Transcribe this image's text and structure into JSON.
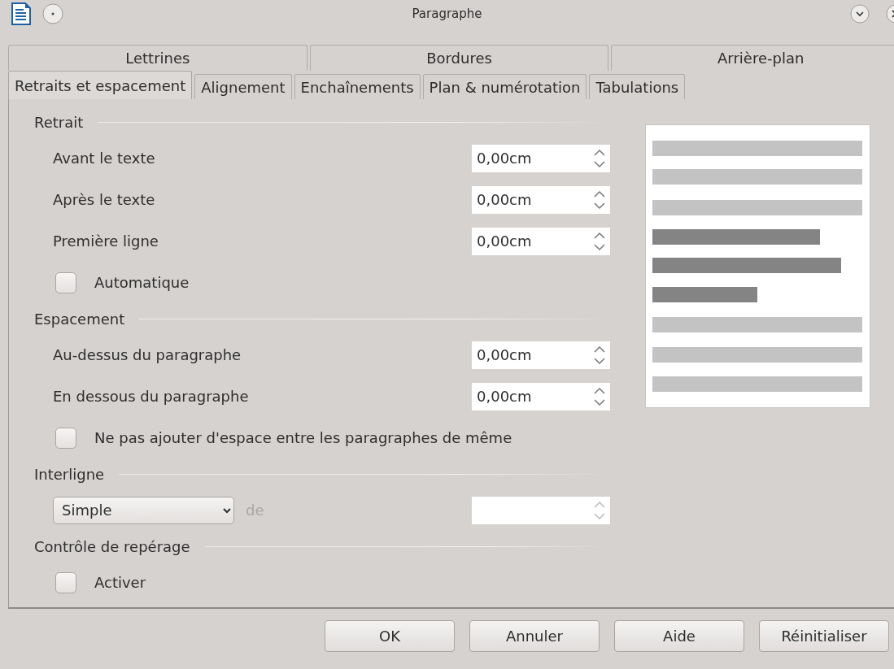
{
  "window": {
    "title": "Paragraphe"
  },
  "tab_rows": [
    {
      "tabs": [
        {
          "label": "Lettrines",
          "selected": false
        },
        {
          "label": "Bordures",
          "selected": false
        },
        {
          "label": "Arrière-plan",
          "selected": false
        }
      ]
    },
    {
      "tabs": [
        {
          "label": "Retraits et espacement",
          "selected": true
        },
        {
          "label": "Alignement",
          "selected": false
        },
        {
          "label": "Enchaînements",
          "selected": false
        },
        {
          "label": "Plan & numérotation",
          "selected": false
        },
        {
          "label": "Tabulations",
          "selected": false
        }
      ]
    }
  ],
  "sections": [
    {
      "title": "Retrait",
      "items": [
        {
          "kind": "spin",
          "label": "Avant le texte",
          "value": "0,00cm"
        },
        {
          "kind": "spin",
          "label": "Après le texte",
          "value": "0,00cm"
        },
        {
          "kind": "spin",
          "label": "Première ligne",
          "value": "0,00cm"
        },
        {
          "kind": "check",
          "label": "Automatique",
          "checked": false
        }
      ]
    },
    {
      "title": "Espacement",
      "items": [
        {
          "kind": "spin",
          "label": "Au-dessus du paragraphe",
          "value": "0,00cm"
        },
        {
          "kind": "spin",
          "label": "En dessous du paragraphe",
          "value": "0,00cm"
        },
        {
          "kind": "check",
          "label": "Ne pas ajouter d'espace entre les paragraphes de même",
          "checked": false
        }
      ]
    },
    {
      "title": "Interligne",
      "items": [
        {
          "kind": "select_spin",
          "value": "Simple",
          "label": "de",
          "disabled": true
        }
      ]
    },
    {
      "title": "Contrôle de repérage",
      "items": [
        {
          "kind": "check",
          "label": "Activer",
          "checked": false
        }
      ]
    }
  ],
  "buttons": [
    {
      "label": "OK"
    },
    {
      "label": "Annuler"
    },
    {
      "label": "Aide"
    },
    {
      "label": "Réinitialiser"
    }
  ]
}
